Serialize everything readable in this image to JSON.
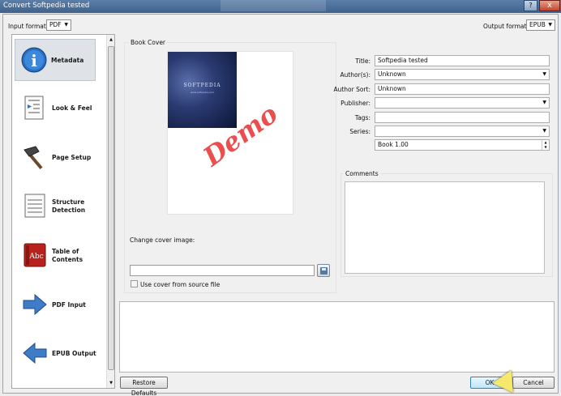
{
  "window": {
    "title": "Convert Softpedia tested",
    "help_glyph": "?",
    "close_glyph": "x"
  },
  "header": {
    "input_format_label": "Input format:",
    "input_format_value": "PDF",
    "output_format_label": "Output format:",
    "output_format_value": "EPUB"
  },
  "sidebar": {
    "items": [
      {
        "label": "Metadata",
        "icon": "info-icon",
        "selected": true
      },
      {
        "label": "Look & Feel",
        "icon": "indent-document-icon"
      },
      {
        "label": "Page Setup",
        "icon": "hammer-icon"
      },
      {
        "label": "Structure\nDetection",
        "icon": "document-lines-icon"
      },
      {
        "label": "Table of\nContents",
        "icon": "red-book-icon"
      },
      {
        "label": "PDF Input",
        "icon": "arrow-right-icon"
      },
      {
        "label": "EPUB Output",
        "icon": "arrow-left-icon"
      }
    ]
  },
  "cover": {
    "section_label": "Book Cover",
    "cover_brand": "SOFTPEDIA",
    "cover_url": "www.softpedia.com",
    "watermark": "Demo",
    "change_cover_label": "Change cover image:",
    "path_value": "",
    "use_source_label": "Use cover from source file",
    "use_source_checked": false
  },
  "metadata": {
    "title_label": "Title:",
    "title_value": "Softpedia tested",
    "authors_label": "Author(s):",
    "authors_value": "Unknown",
    "author_sort_label": "Author Sort:",
    "author_sort_value": "Unknown",
    "publisher_label": "Publisher:",
    "publisher_value": "",
    "tags_label": "Tags:",
    "tags_value": "",
    "series_label": "Series:",
    "series_value": "",
    "book_number_value": "Book 1.00",
    "comments_label": "Comments",
    "comments_value": ""
  },
  "footer": {
    "restore_label": "Restore Defaults",
    "ok_label": "OK",
    "cancel_label": "Cancel"
  },
  "colors": {
    "titlebar": "#3f628c",
    "demo_watermark": "#e83030",
    "ok_button": "#bee6fd"
  }
}
